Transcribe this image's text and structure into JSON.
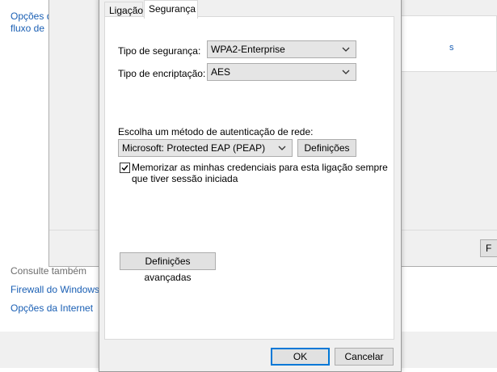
{
  "background": {
    "sidebar_top": [
      "Opções d",
      "fluxo de"
    ],
    "see_also_heading": "Consulte também",
    "links": [
      "Firewall do Windows",
      "Opções da Internet"
    ]
  },
  "middle_dialog": {
    "link_fragment": "s",
    "button_fragment": "F"
  },
  "dialog": {
    "tabs": [
      {
        "label": "Ligação",
        "active": false
      },
      {
        "label": "Segurança",
        "active": true
      }
    ],
    "security_type": {
      "label": "Tipo de segurança:",
      "value": "WPA2-Enterprise"
    },
    "encryption_type": {
      "label": "Tipo de encriptação:",
      "value": "AES"
    },
    "auth_method": {
      "label": "Escolha um método de autenticação de rede:",
      "value": "Microsoft: Protected EAP (PEAP)",
      "settings_button": "Definições"
    },
    "remember_credentials": {
      "checked": true,
      "line1": "Memorizar as minhas credenciais para esta ligação sempre",
      "line2": "que tiver sessão iniciada"
    },
    "advanced_button": "Definições avançadas",
    "ok_button": "OK",
    "cancel_button": "Cancelar"
  }
}
